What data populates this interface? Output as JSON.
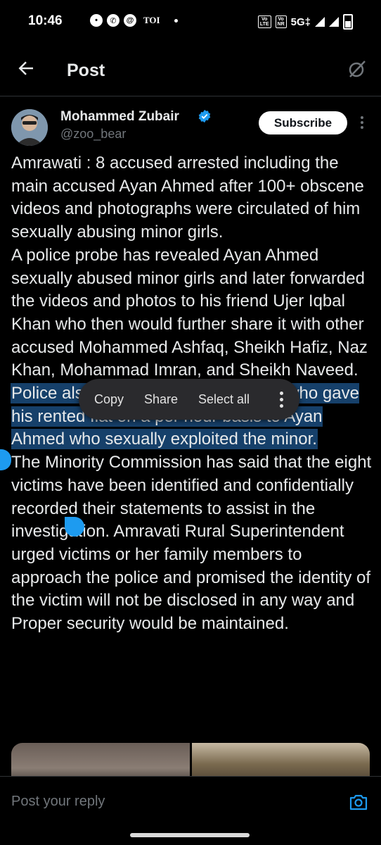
{
  "status_bar": {
    "time": "10:46",
    "toi": "TOI",
    "network": "5G‡",
    "volte1": "Vo LTE",
    "volte2": "Vo NR"
  },
  "header": {
    "title": "Post"
  },
  "author": {
    "name": "Mohammed Zubair",
    "handle": "@zoo_bear",
    "subscribe_label": "Subscribe"
  },
  "post": {
    "p1": "Amrawati : 8 accused arrested including the main accused Ayan Ahmed after 100+ obscene videos and photographs were circulated of him sexually abusing minor girls.",
    "p2": "A police probe has revealed Ayan Ahmed sexually abused minor girls and later forwarded the videos and photos to his friend Ujer Iqbal Khan who then would further share it with other accused Mohammed Ashfaq, Sheikh Hafiz, Naz Khan, Mohammad Imran, and Sheikh Naveed.",
    "p3_selected": "Police also arrested Manav Deepak, who gave his rented flat on a per hour basis to Ayan Ahmed who sexually exploited the minor.",
    "p4": "The Minority Commission has said that the eight victims have been identified and confidentially recorded their statements to assist in the investigation. Amravati Rural Superintendent urged victims or her family members to approach the police and promised the identity of the victim will not be disclosed in any way and Proper security would be maintained."
  },
  "context_menu": {
    "copy": "Copy",
    "share": "Share",
    "select_all": "Select all"
  },
  "reply": {
    "placeholder": "Post your reply"
  },
  "colors": {
    "accent": "#1d9bf0",
    "selection": "#16406a",
    "background": "#000000"
  }
}
